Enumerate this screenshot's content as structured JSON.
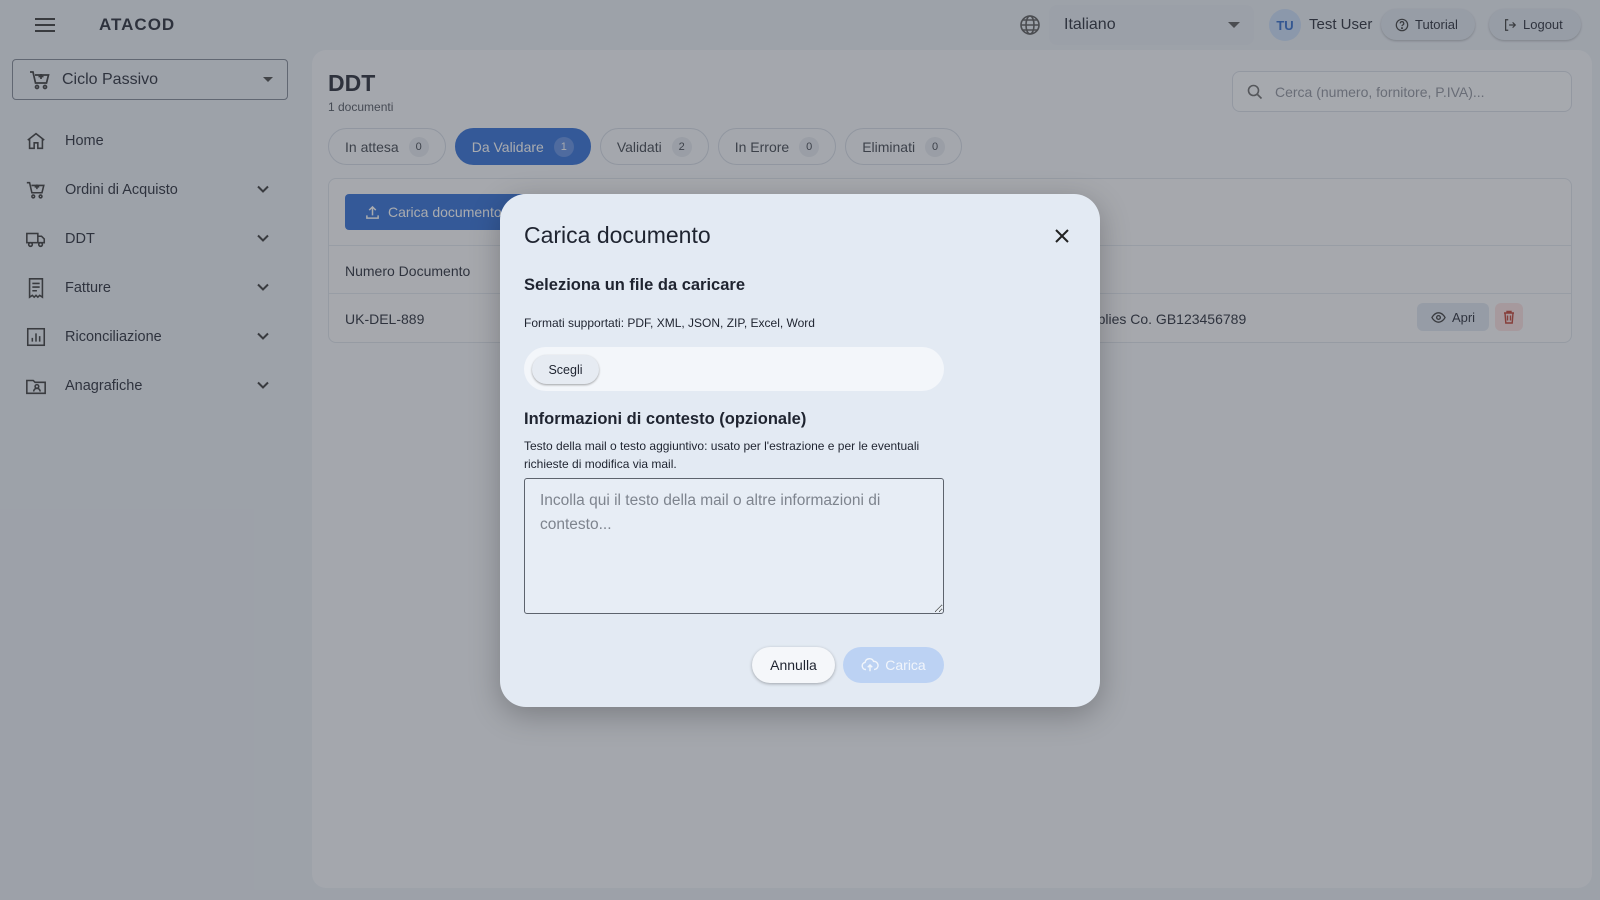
{
  "app": {
    "brand": "ATACOD"
  },
  "header": {
    "language": "Italiano",
    "avatar_initials": "TU",
    "user_name": "Test User",
    "tutorial_label": "Tutorial",
    "logout_label": "Logout"
  },
  "sidebar": {
    "cycle": "Ciclo Passivo",
    "items": [
      {
        "label": "Home",
        "icon": "home-icon"
      },
      {
        "label": "Ordini di Acquisto",
        "icon": "cart-icon"
      },
      {
        "label": "DDT",
        "icon": "truck-icon"
      },
      {
        "label": "Fatture",
        "icon": "receipt-icon"
      },
      {
        "label": "Riconciliazione",
        "icon": "chart-icon"
      },
      {
        "label": "Anagrafiche",
        "icon": "folder-user-icon"
      }
    ]
  },
  "main": {
    "title": "DDT",
    "count": "1 documenti",
    "search_placeholder": "Cerca (numero, fornitore, P.IVA)...",
    "tabs": [
      {
        "label": "In attesa",
        "count": "0"
      },
      {
        "label": "Da Validare",
        "count": "1"
      },
      {
        "label": "Validati",
        "count": "2"
      },
      {
        "label": "In Errore",
        "count": "0"
      },
      {
        "label": "Eliminati",
        "count": "0"
      }
    ],
    "upload_label": "Carica documento",
    "table": {
      "header": "Numero Documento",
      "row": {
        "doc_number": "UK-DEL-889",
        "supplier": "upplies Co. GB123456789",
        "open_label": "Apri"
      }
    }
  },
  "modal": {
    "title": "Carica documento",
    "file_section_title": "Seleziona un file da caricare",
    "formats": "Formati supportati: PDF, XML, JSON, ZIP, Excel, Word",
    "choose_label": "Scegli",
    "context_title": "Informazioni di contesto (opzionale)",
    "context_description": "Testo della mail o testo aggiuntivo: usato per l'estrazione e per le eventuali richieste di modifica via mail.",
    "context_placeholder": "Incolla qui il testo della mail o altre informazioni di contesto...",
    "cancel_label": "Annulla",
    "submit_label": "Carica"
  },
  "colors": {
    "accent": "#2a6ad6",
    "accent_disabled": "#bcd2f3",
    "danger_bg": "#f9dede"
  }
}
